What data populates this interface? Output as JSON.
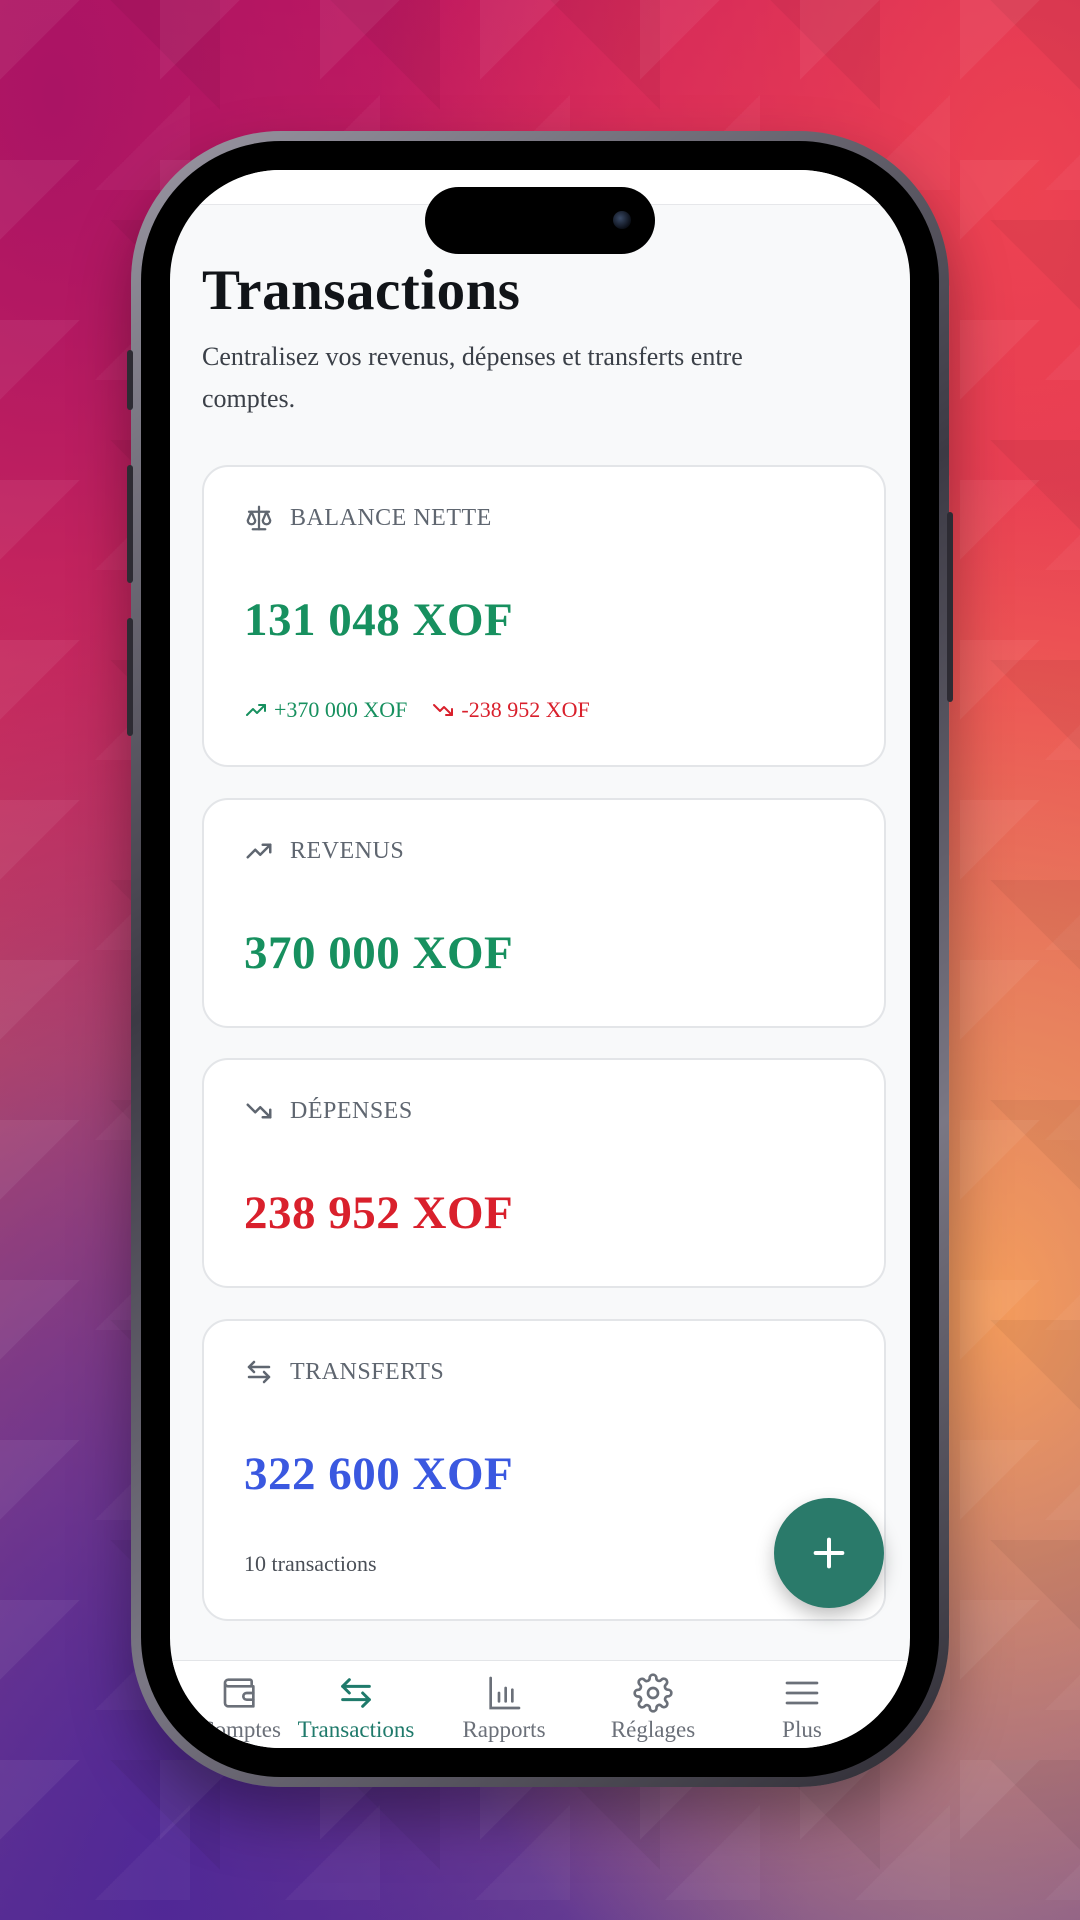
{
  "page": {
    "title": "Transactions",
    "subtitle": "Centralisez vos revenus, dépenses et transferts entre comptes."
  },
  "cards": {
    "balance": {
      "label": "BALANCE NETTE",
      "amount": "131 048 XOF",
      "income_delta": "+370 000 XOF",
      "expense_delta": "-238 952 XOF"
    },
    "revenus": {
      "label": "REVENUS",
      "amount": "370 000 XOF"
    },
    "depenses": {
      "label": "DÉPENSES",
      "amount": "238 952 XOF"
    },
    "transferts": {
      "label": "TRANSFERTS",
      "amount": "322 600 XOF",
      "count": "10 transactions"
    }
  },
  "fab": {
    "icon": "plus-icon"
  },
  "nav": {
    "items": [
      {
        "label": "Comptes",
        "icon": "wallet-icon",
        "active": false
      },
      {
        "label": "Transactions",
        "icon": "transfer-arrows-icon",
        "active": true
      },
      {
        "label": "Rapports",
        "icon": "bar-chart-icon",
        "active": false
      },
      {
        "label": "Réglages",
        "icon": "gear-icon",
        "active": false
      },
      {
        "label": "Plus",
        "icon": "menu-icon",
        "active": false
      }
    ]
  },
  "colors": {
    "positive": "#17905f",
    "negative": "#d9202c",
    "transfer": "#3a58e0",
    "accent": "#2a7a6a"
  }
}
